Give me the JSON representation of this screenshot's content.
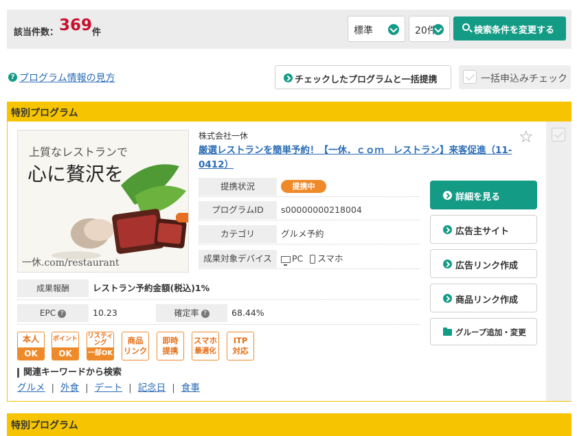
{
  "result": {
    "label": "該当件数：",
    "count": "369",
    "unit": "件"
  },
  "controls": {
    "sort_value": "標準",
    "per_page_value": "20件",
    "search_button": "検索条件を変更する"
  },
  "guide": {
    "help_link": "プログラム情報の見方",
    "bulk_button": "チェックしたプログラムと一括提携",
    "bulk_check_label": "一括申込みチェック"
  },
  "section_title": "特別プログラム",
  "program": {
    "banner": {
      "line1": "上質なレストランで",
      "line2": "心に贅沢を",
      "logo": "一休.com/restaurant"
    },
    "company": "株式会社一休",
    "title": "厳選レストランを簡単予約！【一休．ｃｏｍ　レストラン】来客促進（11-0412）",
    "info": [
      {
        "label": "提携状況",
        "value": "提携中"
      },
      {
        "label": "プログラムID",
        "value": "s00000000218004"
      },
      {
        "label": "カテゴリ",
        "value": "グルメ予約"
      },
      {
        "label": "成果対象デバイス",
        "pc": "PC",
        "sp": "スマホ"
      }
    ],
    "reward": {
      "label": "成果報酬",
      "value": "レストラン予約金額(税込)1%"
    },
    "epc": {
      "label": "EPC",
      "value": "10.23"
    },
    "approval": {
      "label": "確定率",
      "value": "68.44%"
    },
    "tags": [
      {
        "top": "本人",
        "bottom": "OK"
      },
      {
        "top": "ポイント",
        "bottom": "OK"
      },
      {
        "top": "リスティング",
        "bottom": "一部OK"
      },
      {
        "line1": "商品",
        "line2": "リンク"
      },
      {
        "line1": "即時",
        "line2": "提携"
      },
      {
        "line1": "スマホ",
        "line2": "最適化"
      },
      {
        "line1": "ITP",
        "line2": "対応"
      }
    ],
    "keywords_title": "関連キーワードから検索",
    "keywords": [
      "グルメ",
      "外食",
      "デート",
      "記念日",
      "食事"
    ],
    "actions": {
      "detail": "詳細を見る",
      "advertiser_site": "広告主サイト",
      "ad_link": "広告リンク作成",
      "product_link": "商品リンク作成",
      "group": "グループ追加・変更"
    }
  },
  "colors": {
    "accent": "#149b86",
    "highlight": "#f6c400",
    "count": "#c8102e",
    "tag": "#ee8a2a",
    "link": "#2a6cb5"
  },
  "icons": [
    "chevron-down-icon",
    "search-icon",
    "question-icon",
    "arrow-right-circle-icon",
    "checkbox-icon",
    "star-icon",
    "pc-icon",
    "smartphone-icon",
    "folder-icon"
  ]
}
